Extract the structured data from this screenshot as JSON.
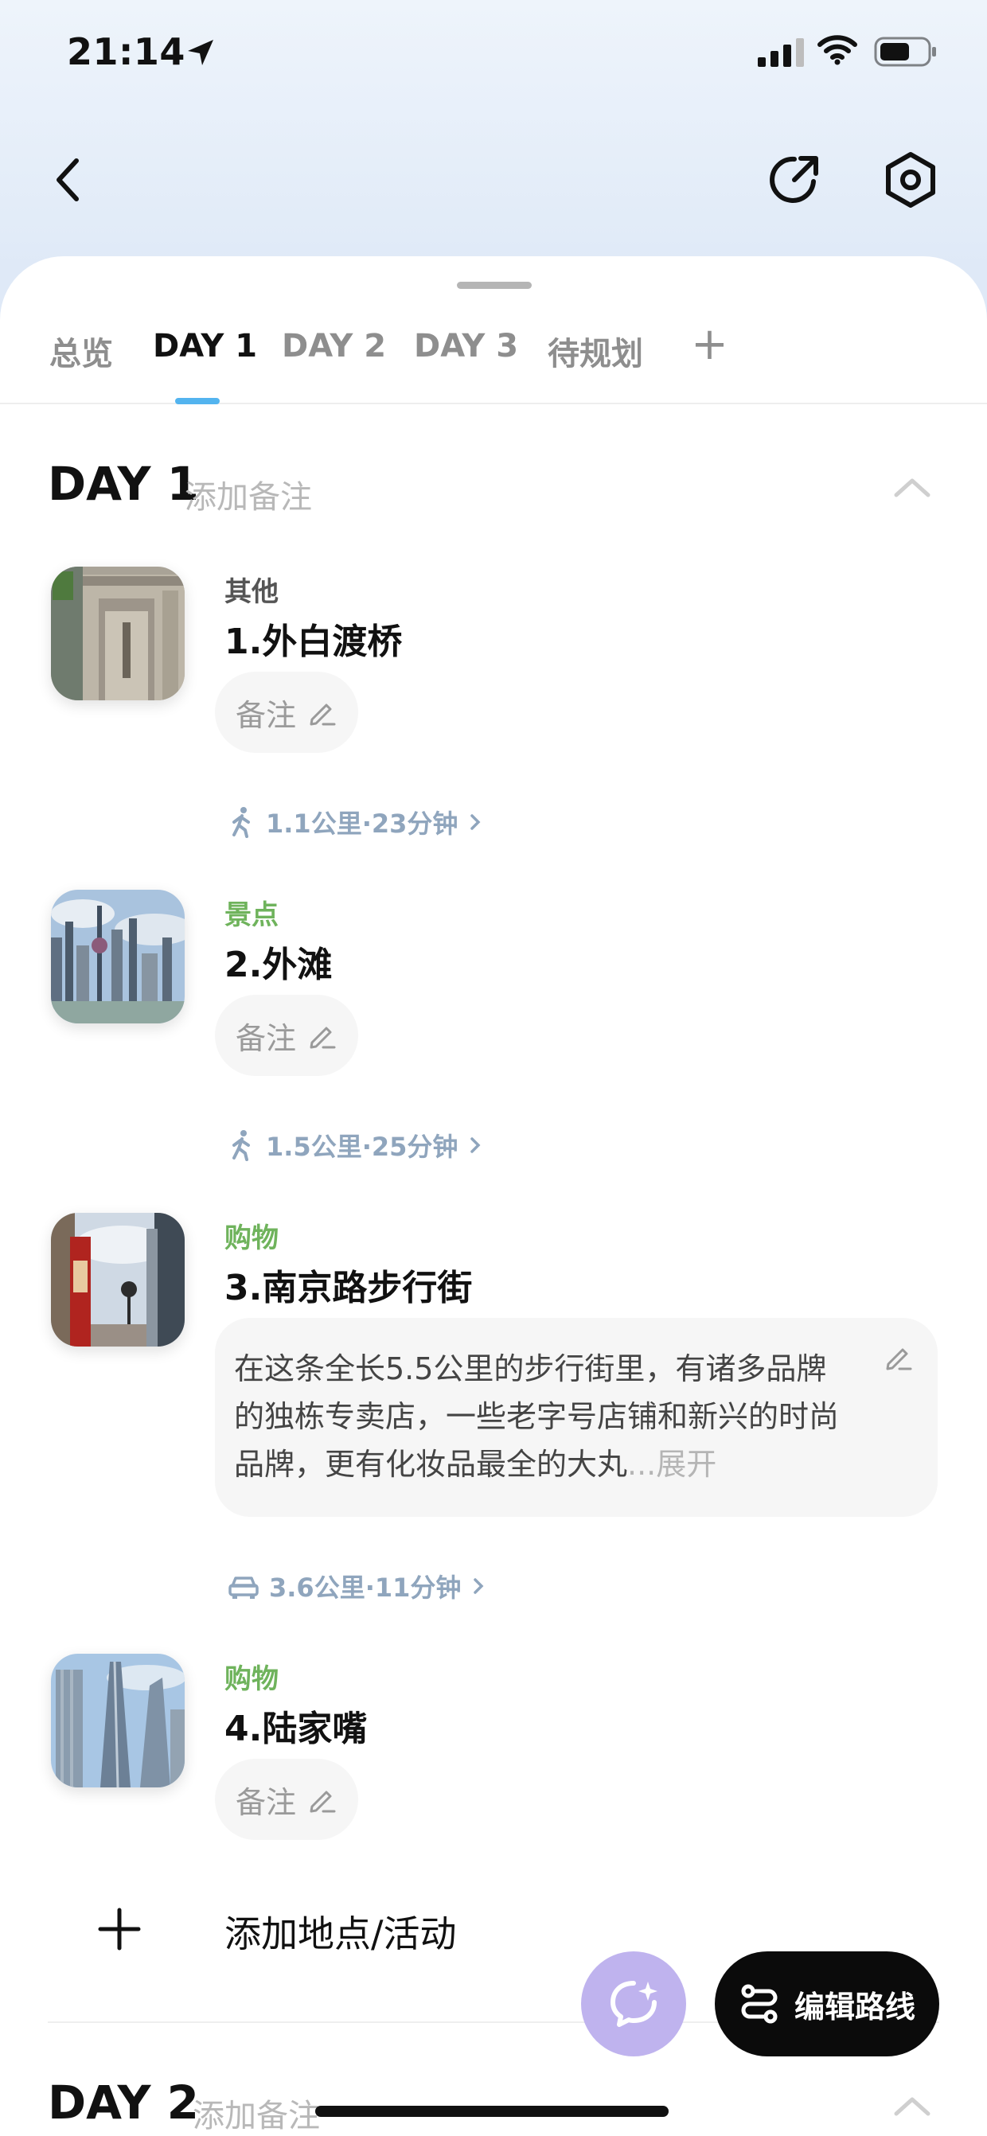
{
  "status_bar": {
    "time": "21:14"
  },
  "tabs": [
    {
      "label": "总览",
      "active": false
    },
    {
      "label": "DAY 1",
      "active": true
    },
    {
      "label": "DAY 2",
      "active": false
    },
    {
      "label": "DAY 3",
      "active": false
    },
    {
      "label": "待规划",
      "active": false
    },
    {
      "label": "+",
      "active": false
    }
  ],
  "day1": {
    "title": "DAY 1",
    "note_placeholder": "添加备注",
    "places": [
      {
        "category": "其他",
        "name": "1.外白渡桥",
        "note": "备注"
      },
      {
        "category": "景点",
        "name": "2.外滩",
        "note": "备注"
      },
      {
        "category": "购物",
        "name": "3.南京路步行街",
        "description": "在这条全长5.5公里的步行街里，有诸多品牌的独栋专卖店，一些老字号店铺和新兴的时尚品牌，更有化妆品最全的大丸",
        "description_more": "...展开"
      },
      {
        "category": "购物",
        "name": "4.陆家嘴",
        "note": "备注"
      }
    ],
    "routes": [
      {
        "mode": "walk",
        "text": "1.1公里·23分钟"
      },
      {
        "mode": "walk",
        "text": "1.5公里·25分钟"
      },
      {
        "mode": "car",
        "text": "3.6公里·11分钟"
      }
    ],
    "add_label": "添加地点/活动"
  },
  "day2": {
    "title": "DAY 2",
    "note_placeholder": "添加备注"
  },
  "fab": {
    "edit_route_label": "编辑路线"
  },
  "colors": {
    "accent_tab": "#53b4ef",
    "category_green": "#6fb35c",
    "fab_ai": "#bfb3ee"
  }
}
